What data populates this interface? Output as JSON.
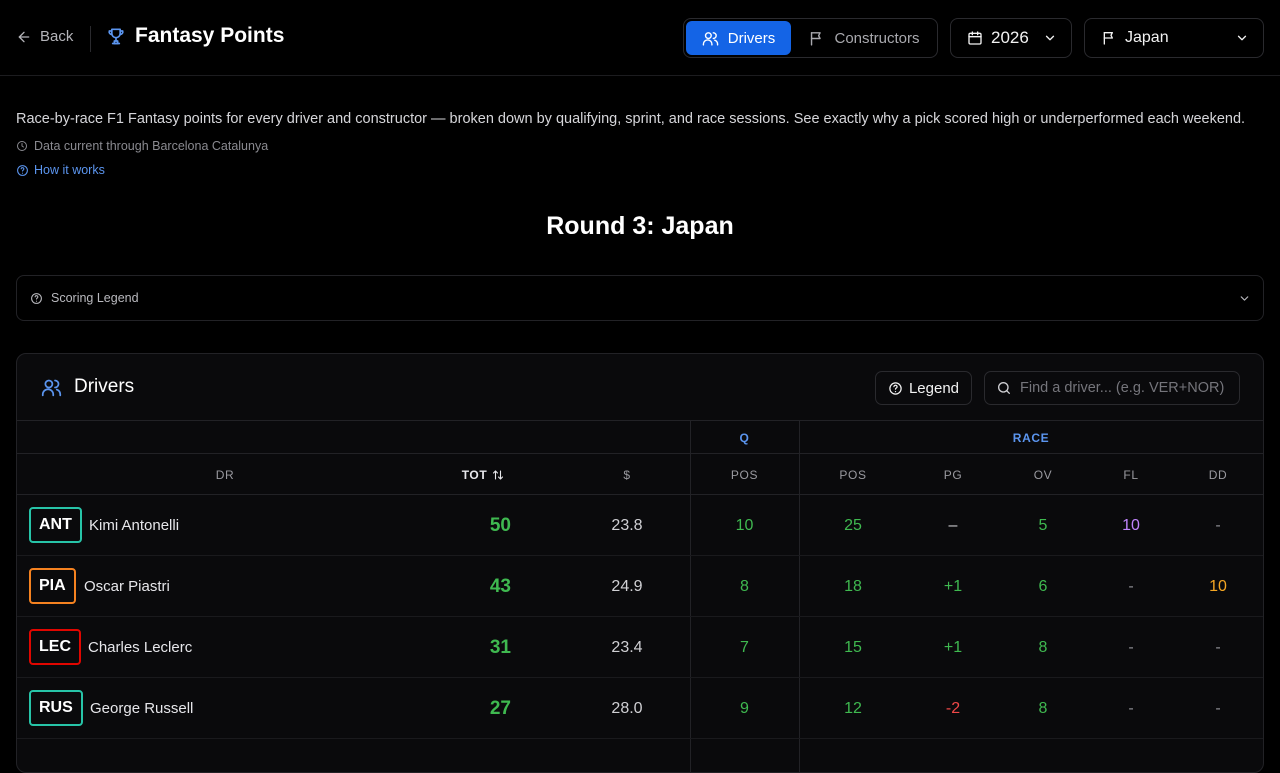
{
  "header": {
    "back_label": "Back",
    "title": "Fantasy Points",
    "tabs": [
      {
        "label": "Drivers",
        "active": true
      },
      {
        "label": "Constructors",
        "active": false
      }
    ],
    "season": "2026",
    "grand_prix": "Japan"
  },
  "intro": {
    "description": "Race-by-race F1 Fantasy points for every driver and constructor — broken down by qualifying, sprint, and race sessions. See exactly why a pick scored high or underperformed each weekend.",
    "data_current": "Data current through Barcelona Catalunya",
    "how_it_works": "How it works"
  },
  "round_title": "Round 3: Japan",
  "scoring_legend": "Scoring Legend",
  "table": {
    "title": "Drivers",
    "legend_label": "Legend",
    "search_placeholder": "Find a driver... (e.g. VER+NOR)",
    "groups": {
      "q": "Q",
      "race": "RACE"
    },
    "columns": {
      "dr": "DR",
      "tot": "TOT",
      "price": "$",
      "q_pos": "POS",
      "race_pos": "POS",
      "pg": "PG",
      "ov": "OV",
      "fl": "FL",
      "dd": "DD"
    },
    "rows": [
      {
        "code": "ANT",
        "name": "Kimi Antonelli",
        "team_color": "#27c4a8",
        "tot": "50",
        "price": "23.8",
        "q_pos": "10",
        "race_pos": "25",
        "pg": "–",
        "ov": "5",
        "fl": "10",
        "dd": "-"
      },
      {
        "code": "PIA",
        "name": "Oscar Piastri",
        "team_color": "#f58220",
        "tot": "43",
        "price": "24.9",
        "q_pos": "8",
        "race_pos": "18",
        "pg": "+1",
        "ov": "6",
        "fl": "-",
        "dd": "10"
      },
      {
        "code": "LEC",
        "name": "Charles Leclerc",
        "team_color": "#e10600",
        "tot": "31",
        "price": "23.4",
        "q_pos": "7",
        "race_pos": "15",
        "pg": "+1",
        "ov": "8",
        "fl": "-",
        "dd": "-"
      },
      {
        "code": "RUS",
        "name": "George Russell",
        "team_color": "#27c4a8",
        "tot": "27",
        "price": "28.0",
        "q_pos": "9",
        "race_pos": "12",
        "pg": "-2",
        "ov": "8",
        "fl": "-",
        "dd": "-"
      }
    ]
  },
  "colors": {
    "accent": "#1464e6",
    "positive": "#3fb950",
    "negative": "#f04848",
    "purple": "#c084fc",
    "orange": "#f5a623",
    "link": "#5b95ef"
  }
}
